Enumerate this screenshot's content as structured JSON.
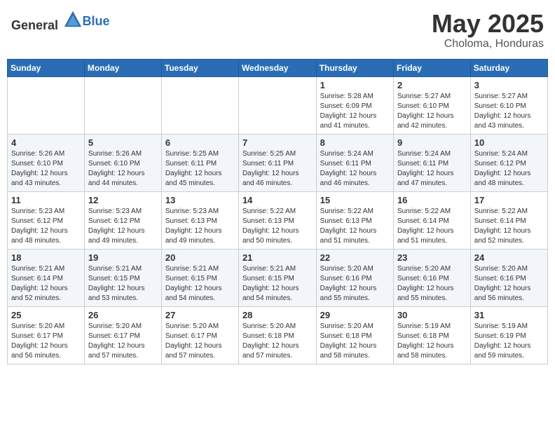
{
  "header": {
    "logo_general": "General",
    "logo_blue": "Blue",
    "month": "May 2025",
    "location": "Choloma, Honduras"
  },
  "days_of_week": [
    "Sunday",
    "Monday",
    "Tuesday",
    "Wednesday",
    "Thursday",
    "Friday",
    "Saturday"
  ],
  "weeks": [
    [
      {
        "day": "",
        "info": ""
      },
      {
        "day": "",
        "info": ""
      },
      {
        "day": "",
        "info": ""
      },
      {
        "day": "",
        "info": ""
      },
      {
        "day": "1",
        "info": "Sunrise: 5:28 AM\nSunset: 6:09 PM\nDaylight: 12 hours\nand 41 minutes."
      },
      {
        "day": "2",
        "info": "Sunrise: 5:27 AM\nSunset: 6:10 PM\nDaylight: 12 hours\nand 42 minutes."
      },
      {
        "day": "3",
        "info": "Sunrise: 5:27 AM\nSunset: 6:10 PM\nDaylight: 12 hours\nand 43 minutes."
      }
    ],
    [
      {
        "day": "4",
        "info": "Sunrise: 5:26 AM\nSunset: 6:10 PM\nDaylight: 12 hours\nand 43 minutes."
      },
      {
        "day": "5",
        "info": "Sunrise: 5:26 AM\nSunset: 6:10 PM\nDaylight: 12 hours\nand 44 minutes."
      },
      {
        "day": "6",
        "info": "Sunrise: 5:25 AM\nSunset: 6:11 PM\nDaylight: 12 hours\nand 45 minutes."
      },
      {
        "day": "7",
        "info": "Sunrise: 5:25 AM\nSunset: 6:11 PM\nDaylight: 12 hours\nand 46 minutes."
      },
      {
        "day": "8",
        "info": "Sunrise: 5:24 AM\nSunset: 6:11 PM\nDaylight: 12 hours\nand 46 minutes."
      },
      {
        "day": "9",
        "info": "Sunrise: 5:24 AM\nSunset: 6:11 PM\nDaylight: 12 hours\nand 47 minutes."
      },
      {
        "day": "10",
        "info": "Sunrise: 5:24 AM\nSunset: 6:12 PM\nDaylight: 12 hours\nand 48 minutes."
      }
    ],
    [
      {
        "day": "11",
        "info": "Sunrise: 5:23 AM\nSunset: 6:12 PM\nDaylight: 12 hours\nand 48 minutes."
      },
      {
        "day": "12",
        "info": "Sunrise: 5:23 AM\nSunset: 6:12 PM\nDaylight: 12 hours\nand 49 minutes."
      },
      {
        "day": "13",
        "info": "Sunrise: 5:23 AM\nSunset: 6:13 PM\nDaylight: 12 hours\nand 49 minutes."
      },
      {
        "day": "14",
        "info": "Sunrise: 5:22 AM\nSunset: 6:13 PM\nDaylight: 12 hours\nand 50 minutes."
      },
      {
        "day": "15",
        "info": "Sunrise: 5:22 AM\nSunset: 6:13 PM\nDaylight: 12 hours\nand 51 minutes."
      },
      {
        "day": "16",
        "info": "Sunrise: 5:22 AM\nSunset: 6:14 PM\nDaylight: 12 hours\nand 51 minutes."
      },
      {
        "day": "17",
        "info": "Sunrise: 5:22 AM\nSunset: 6:14 PM\nDaylight: 12 hours\nand 52 minutes."
      }
    ],
    [
      {
        "day": "18",
        "info": "Sunrise: 5:21 AM\nSunset: 6:14 PM\nDaylight: 12 hours\nand 52 minutes."
      },
      {
        "day": "19",
        "info": "Sunrise: 5:21 AM\nSunset: 6:15 PM\nDaylight: 12 hours\nand 53 minutes."
      },
      {
        "day": "20",
        "info": "Sunrise: 5:21 AM\nSunset: 6:15 PM\nDaylight: 12 hours\nand 54 minutes."
      },
      {
        "day": "21",
        "info": "Sunrise: 5:21 AM\nSunset: 6:15 PM\nDaylight: 12 hours\nand 54 minutes."
      },
      {
        "day": "22",
        "info": "Sunrise: 5:20 AM\nSunset: 6:16 PM\nDaylight: 12 hours\nand 55 minutes."
      },
      {
        "day": "23",
        "info": "Sunrise: 5:20 AM\nSunset: 6:16 PM\nDaylight: 12 hours\nand 55 minutes."
      },
      {
        "day": "24",
        "info": "Sunrise: 5:20 AM\nSunset: 6:16 PM\nDaylight: 12 hours\nand 56 minutes."
      }
    ],
    [
      {
        "day": "25",
        "info": "Sunrise: 5:20 AM\nSunset: 6:17 PM\nDaylight: 12 hours\nand 56 minutes."
      },
      {
        "day": "26",
        "info": "Sunrise: 5:20 AM\nSunset: 6:17 PM\nDaylight: 12 hours\nand 57 minutes."
      },
      {
        "day": "27",
        "info": "Sunrise: 5:20 AM\nSunset: 6:17 PM\nDaylight: 12 hours\nand 57 minutes."
      },
      {
        "day": "28",
        "info": "Sunrise: 5:20 AM\nSunset: 6:18 PM\nDaylight: 12 hours\nand 57 minutes."
      },
      {
        "day": "29",
        "info": "Sunrise: 5:20 AM\nSunset: 6:18 PM\nDaylight: 12 hours\nand 58 minutes."
      },
      {
        "day": "30",
        "info": "Sunrise: 5:19 AM\nSunset: 6:18 PM\nDaylight: 12 hours\nand 58 minutes."
      },
      {
        "day": "31",
        "info": "Sunrise: 5:19 AM\nSunset: 6:19 PM\nDaylight: 12 hours\nand 59 minutes."
      }
    ]
  ]
}
